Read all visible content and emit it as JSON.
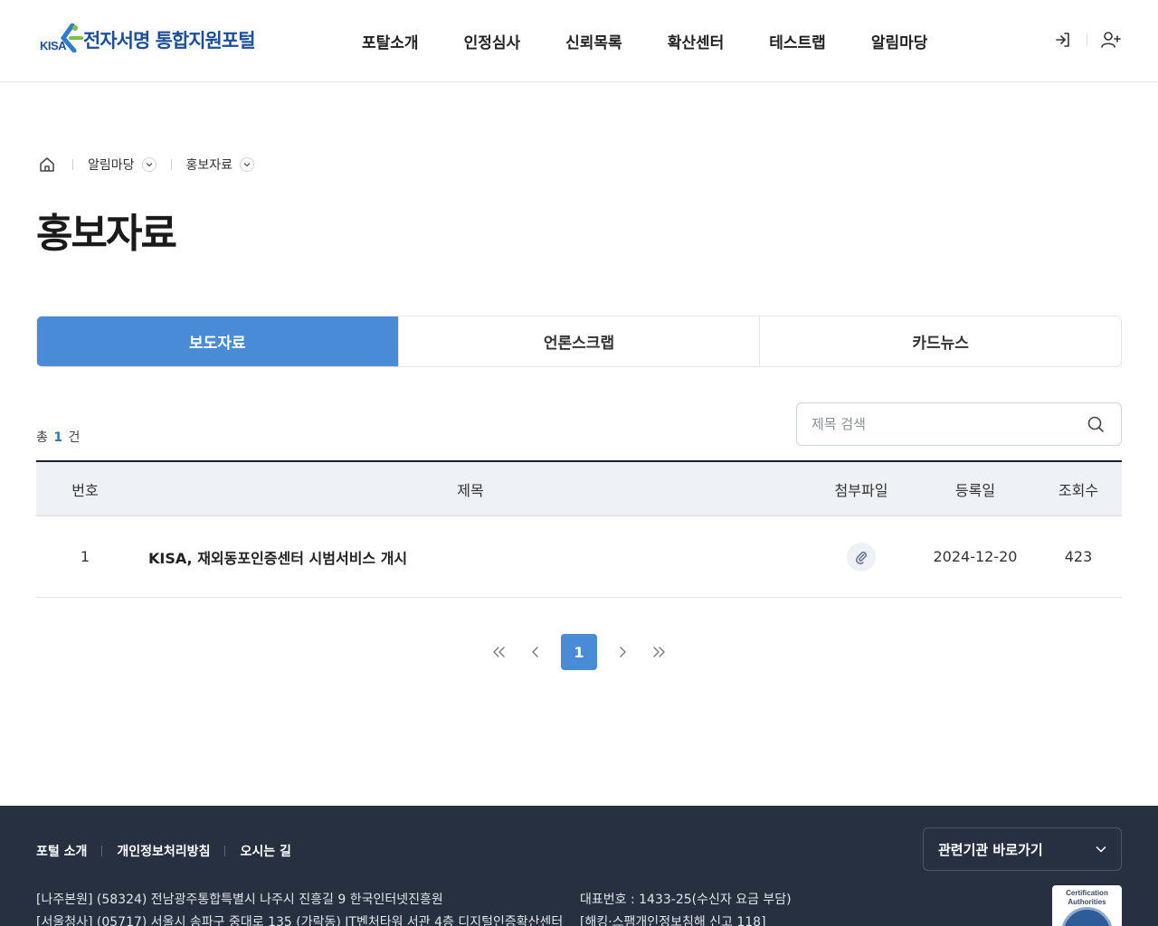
{
  "header": {
    "logo_text": "전자서명 통합지원포털",
    "logo_mark": "KISA",
    "nav": [
      "포탈소개",
      "인정심사",
      "신뢰목록",
      "확산센터",
      "테스트랩",
      "알림마당"
    ]
  },
  "breadcrumb": {
    "items": [
      "알림마당",
      "홍보자료"
    ]
  },
  "page_title": "홍보자료",
  "tabs": [
    {
      "label": "보도자료",
      "active": true
    },
    {
      "label": "언론스크랩",
      "active": false
    },
    {
      "label": "카드뉴스",
      "active": false
    }
  ],
  "total": {
    "prefix": "총",
    "count": "1",
    "suffix": "건"
  },
  "search": {
    "placeholder": "제목 검색"
  },
  "table": {
    "headers": {
      "no": "번호",
      "title": "제목",
      "file": "첨부파일",
      "date": "등록일",
      "views": "조회수"
    },
    "rows": [
      {
        "no": "1",
        "title": "KISA, 재외동포인증센터 시범서비스 개시",
        "has_file": true,
        "date": "2024-12-20",
        "views": "423"
      }
    ]
  },
  "pagination": {
    "current": "1"
  },
  "footer": {
    "links": [
      "포털 소개",
      "개인정보처리방침",
      "오시는 길"
    ],
    "related": "관련기관 바로가기",
    "address": [
      "[나주본원] (58324) 전남광주통합특별시 나주시 진흥길 9 한국인터넷진흥원",
      "[서울청사] (05717) 서울시 송파구 중대로 135 (가락동) IT벤처타워 서관 4층 디지털인증확산센터"
    ],
    "contact": [
      "대표번호 : 1433-25(수신자 요금 부담)",
      "[해킹·스팸개인정보침해 신고 118]"
    ],
    "badge_text": "Certification Authorities"
  },
  "colors": {
    "primary": "#4a8bd8",
    "brand": "#1d4e9c",
    "footer_bg": "#263040"
  }
}
